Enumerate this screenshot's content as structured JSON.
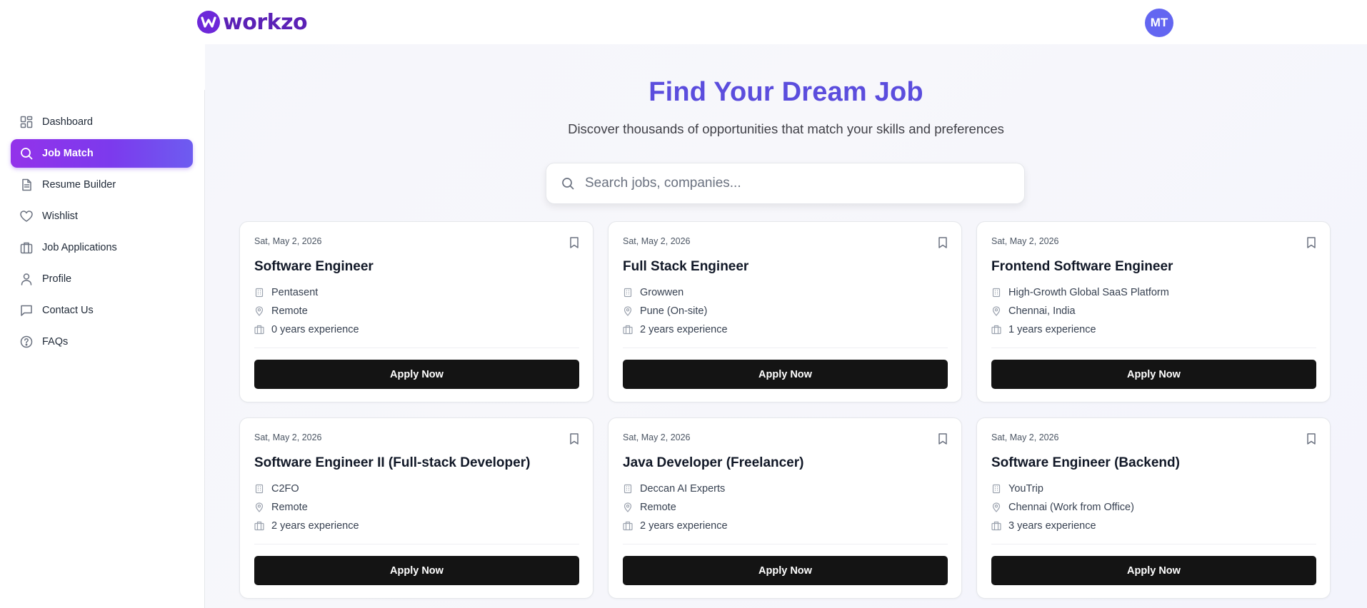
{
  "brand": {
    "name": "workzo"
  },
  "user": {
    "initials": "MT"
  },
  "sidebar": {
    "items": [
      {
        "label": "Dashboard",
        "icon": "dashboard-icon",
        "active": false
      },
      {
        "label": "Job Match",
        "icon": "search-icon",
        "active": true
      },
      {
        "label": "Resume Builder",
        "icon": "document-icon",
        "active": false
      },
      {
        "label": "Wishlist",
        "icon": "heart-icon",
        "active": false
      },
      {
        "label": "Job Applications",
        "icon": "briefcase-icon",
        "active": false
      },
      {
        "label": "Profile",
        "icon": "user-icon",
        "active": false
      },
      {
        "label": "Contact Us",
        "icon": "message-icon",
        "active": false
      },
      {
        "label": "FAQs",
        "icon": "help-circle-icon",
        "active": false
      }
    ]
  },
  "hero": {
    "title": "Find Your Dream Job",
    "subtitle": "Discover thousands of opportunities that match your skills and preferences"
  },
  "search": {
    "placeholder": "Search jobs, companies...",
    "value": ""
  },
  "jobs": [
    {
      "date": "Sat, May 2, 2026",
      "title": "Software Engineer",
      "company": "Pentasent",
      "location": "Remote",
      "experience": "0 years experience",
      "cta": "Apply Now"
    },
    {
      "date": "Sat, May 2, 2026",
      "title": "Full Stack Engineer",
      "company": "Growwen",
      "location": "Pune (On-site)",
      "experience": "2 years experience",
      "cta": "Apply Now"
    },
    {
      "date": "Sat, May 2, 2026",
      "title": "Frontend Software Engineer",
      "company": "High-Growth Global SaaS Platform",
      "location": "Chennai, India",
      "experience": "1 years experience",
      "cta": "Apply Now"
    },
    {
      "date": "Sat, May 2, 2026",
      "title": "Software Engineer II (Full-stack Developer)",
      "company": "C2FO",
      "location": "Remote",
      "experience": "2 years experience",
      "cta": "Apply Now"
    },
    {
      "date": "Sat, May 2, 2026",
      "title": "Java Developer (Freelancer)",
      "company": "Deccan AI Experts",
      "location": "Remote",
      "experience": "2 years experience",
      "cta": "Apply Now"
    },
    {
      "date": "Sat, May 2, 2026",
      "title": "Software Engineer (Backend)",
      "company": "YouTrip",
      "location": "Chennai (Work from Office)",
      "experience": "3 years experience",
      "cta": "Apply Now"
    }
  ],
  "colors": {
    "accent": "#7c3aed",
    "title": "#5b4ddd",
    "avatar": "#6366f1",
    "button": "#141414"
  }
}
